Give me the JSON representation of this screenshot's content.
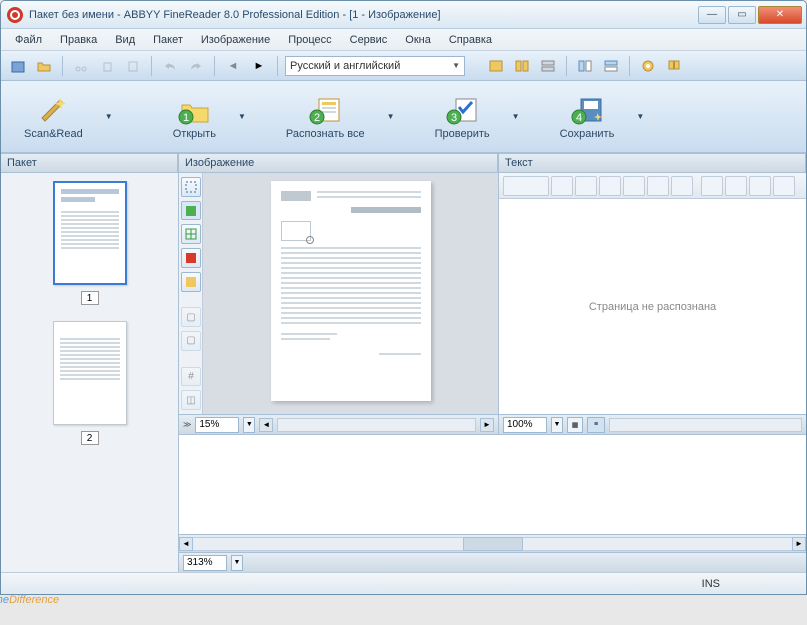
{
  "title": "Пакет без имени - ABBYY FineReader 8.0 Professional Edition - [1 - Изображение]",
  "menu": [
    "Файл",
    "Правка",
    "Вид",
    "Пакет",
    "Изображение",
    "Процесс",
    "Сервис",
    "Окна",
    "Справка"
  ],
  "language_selector": "Русский и английский",
  "big_buttons": {
    "scan": "Scan&Read",
    "open": "Открыть",
    "recognize": "Распознать все",
    "check": "Проверить",
    "save": "Сохранить"
  },
  "panels": {
    "batch": "Пакет",
    "image": "Изображение",
    "text": "Текст"
  },
  "thumbs": [
    {
      "num": "1",
      "selected": true
    },
    {
      "num": "2",
      "selected": false
    }
  ],
  "center_zoom": "15%",
  "right_zoom": "100%",
  "bottom_zoom": "313%",
  "text_message": "Страница не распознана",
  "status": {
    "ins": "INS"
  },
  "watermark": {
    "a": "The",
    "b": "Difference"
  }
}
